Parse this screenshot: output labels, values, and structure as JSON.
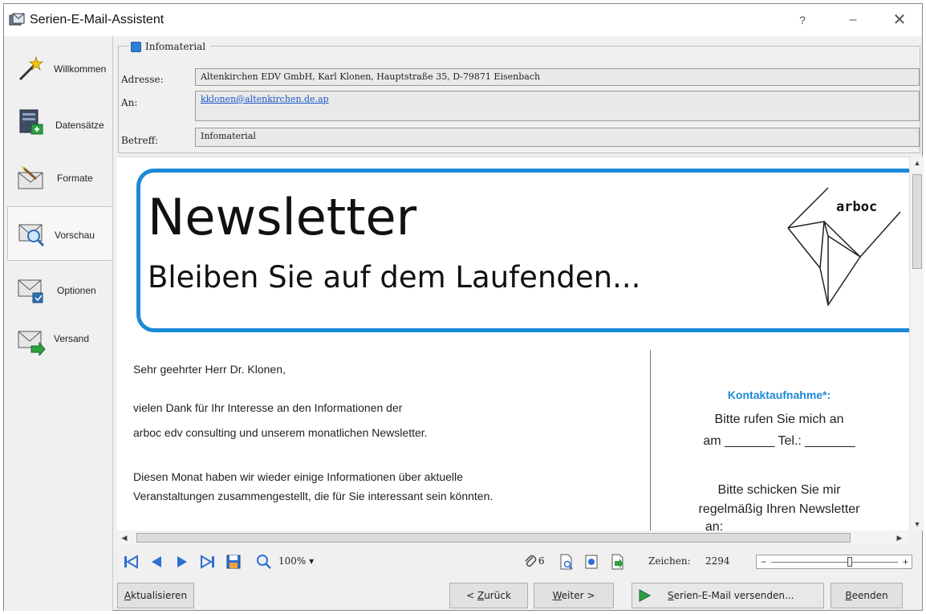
{
  "window": {
    "title": "Serien-E-Mail-Assistent",
    "help": "?",
    "minimize": "–",
    "close": "✕"
  },
  "sidebar": {
    "items": [
      {
        "label": "Willkommen"
      },
      {
        "label": "Datensätze"
      },
      {
        "label": "Formate"
      },
      {
        "label": "Vorschau",
        "active": true
      },
      {
        "label": "Optionen"
      },
      {
        "label": "Versand"
      }
    ]
  },
  "header": {
    "group_label": "Infomaterial",
    "adresse_label": "Adresse:",
    "adresse_value": "Altenkirchen EDV GmbH,  Karl Klonen,  Hauptstraße 35,  D-79871 Eisenbach",
    "an_label": "An:",
    "an_value": "kklonen@altenkirchen.de.ap",
    "betreff_label": "Betreff:",
    "betreff_value": "Infomaterial"
  },
  "preview": {
    "title": "Newsletter",
    "subtitle": "Bleiben Sie auf dem Laufenden...",
    "logo_text": "arboc",
    "salutation": "Sehr geehrter Herr Dr. Klonen,",
    "para1_line1": "vielen Dank für Ihr Interesse an den Informationen der",
    "para1_line2": "arboc edv consulting und unserem monatlichen Newsletter.",
    "para2_line1": "Diesen Monat haben wir wieder einige Informationen über aktuelle",
    "para2_line2": "Veranstaltungen zusammengestellt, die für Sie interessant sein könnten.",
    "contact_heading": "Kontaktaufnahme*:",
    "contact_line1": "Bitte rufen Sie mich an",
    "contact_line2": "am _______ Tel.: _______",
    "contact_line3": "Bitte schicken Sie mir",
    "contact_line4": "regelmäßig Ihren Newsletter",
    "contact_line5": "an:"
  },
  "toolbar": {
    "zoom": "100%",
    "attachment_count": "6",
    "zeichen_label": "Zeichen:",
    "zeichen_value": "2294",
    "zoom_slider_position": 0.62
  },
  "buttons": {
    "refresh": {
      "accel": "A",
      "rest": "ktualisieren"
    },
    "back": {
      "pre": "< ",
      "accel": "Z",
      "rest": "urück"
    },
    "next": {
      "accel": "W",
      "rest": "eiter >"
    },
    "send": {
      "accel": "S",
      "rest": "erien-E-Mail versenden..."
    },
    "finish": {
      "accel": "B",
      "rest": "eenden"
    }
  },
  "colors": {
    "accent": "#1b8ad6",
    "link": "#1a56c8",
    "send_arrow": "#2ea043"
  }
}
